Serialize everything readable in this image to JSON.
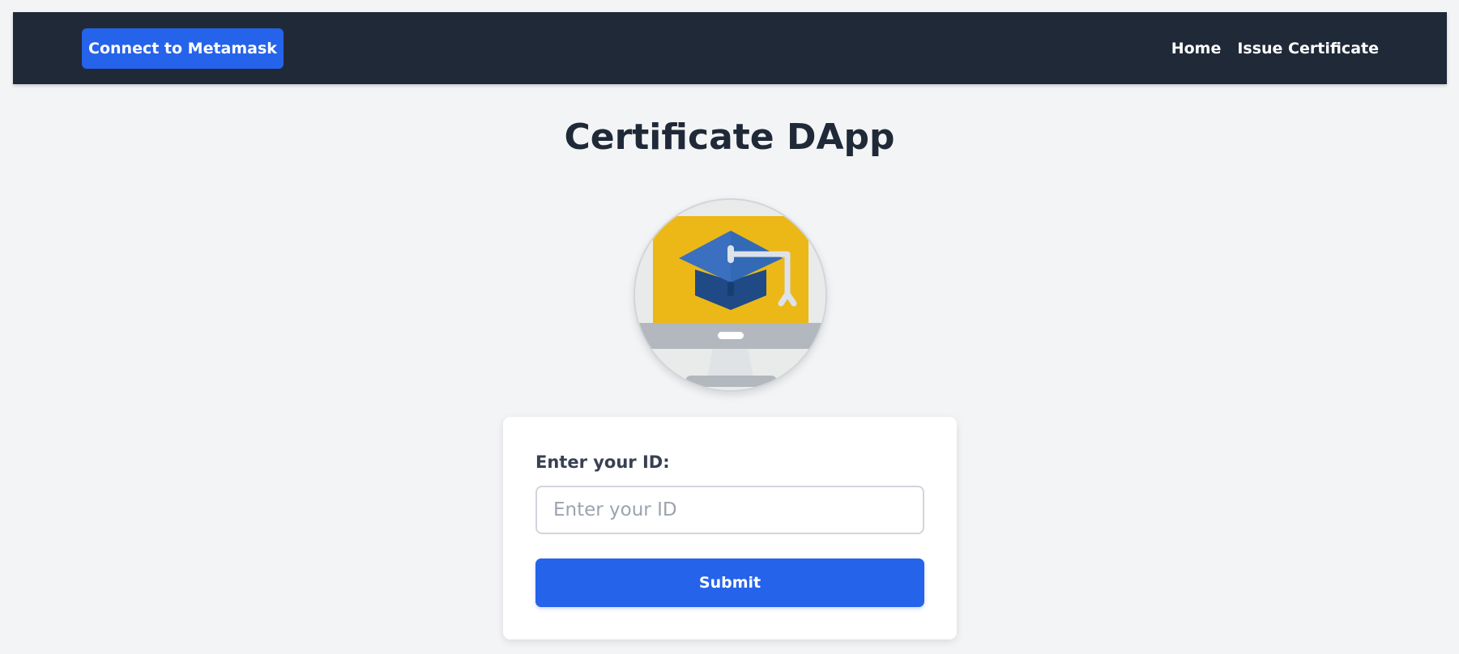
{
  "navbar": {
    "connect_label": "Connect to Metamask",
    "links": [
      {
        "label": "Home"
      },
      {
        "label": "Issue Certificate"
      }
    ]
  },
  "main": {
    "title": "Certificate DApp",
    "logo_icon": "graduation-cap-monitor-icon"
  },
  "form": {
    "id_label": "Enter your ID:",
    "id_placeholder": "Enter your ID",
    "id_value": "",
    "submit_label": "Submit"
  },
  "colors": {
    "navbar_bg": "#1f2937",
    "accent": "#2563eb",
    "page_bg": "#f3f4f6",
    "logo_screen": "#ebb817",
    "logo_cap": "#3b6fbf"
  }
}
